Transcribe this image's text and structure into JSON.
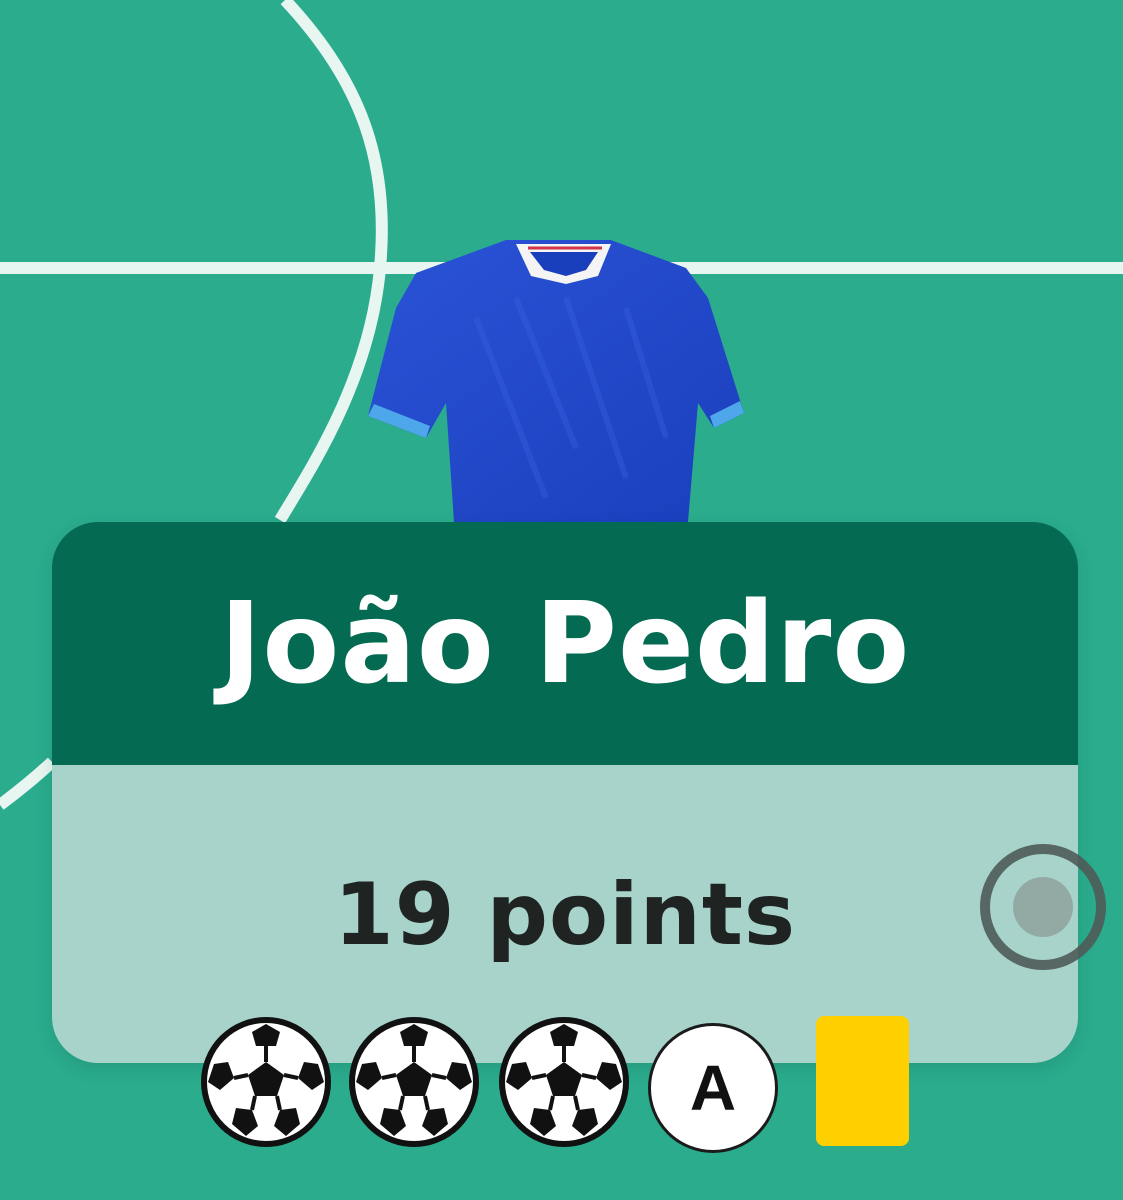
{
  "player": {
    "name": "João Pedro",
    "points_label": "19 points",
    "kit_color": "#1f46c6"
  },
  "badges": {
    "goals": 3,
    "assist_label": "A",
    "yellow_cards": 1
  },
  "colors": {
    "pitch": "#2aac8d",
    "card_header": "#046a51",
    "card_body": "#a7d3cb",
    "yellow_card": "#ffd000"
  }
}
